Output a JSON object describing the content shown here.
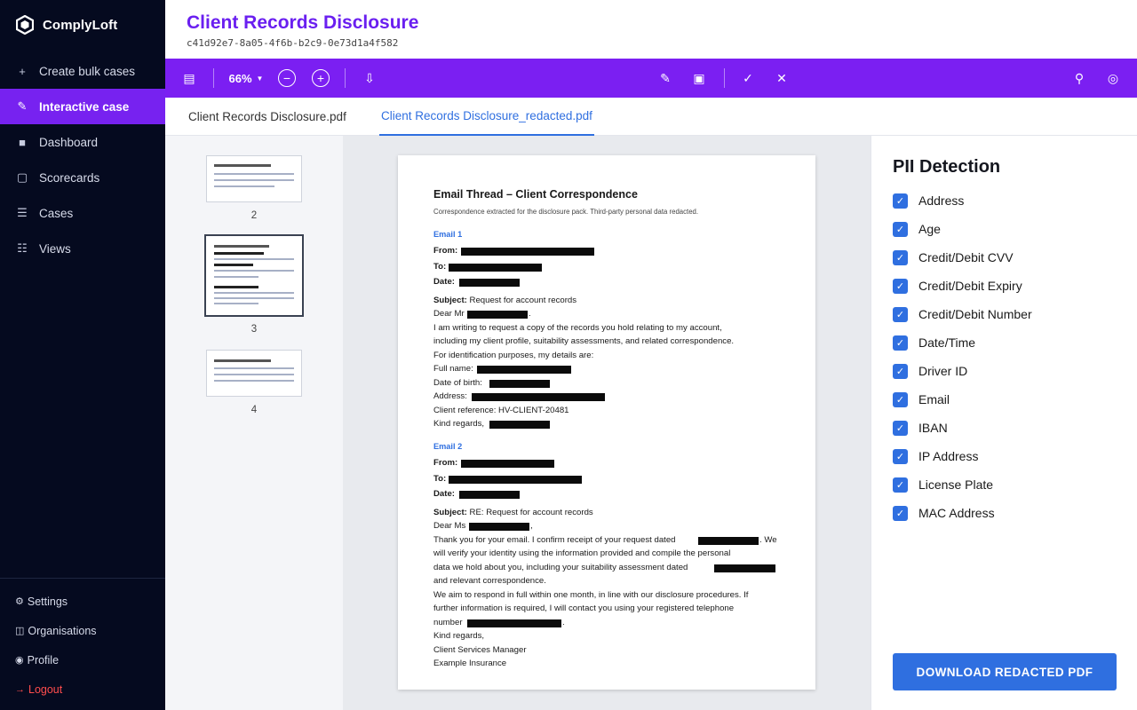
{
  "app": {
    "name": "ComplyLoft"
  },
  "sidebar": {
    "nav": [
      {
        "label": "Create bulk cases",
        "icon": "plus-icon",
        "active": false
      },
      {
        "label": "Interactive case",
        "icon": "pencil-icon",
        "active": true
      },
      {
        "label": "Dashboard",
        "icon": "dashboard-icon",
        "active": false
      },
      {
        "label": "Scorecards",
        "icon": "scorecard-icon",
        "active": false
      },
      {
        "label": "Cases",
        "icon": "list-icon",
        "active": false
      },
      {
        "label": "Views",
        "icon": "views-icon",
        "active": false
      }
    ],
    "bottom": [
      {
        "label": "Settings",
        "icon": "gear-icon"
      },
      {
        "label": "Organisations",
        "icon": "organisations-icon"
      },
      {
        "label": "Profile",
        "icon": "profile-icon"
      },
      {
        "label": "Logout",
        "icon": "logout-arrow-icon"
      }
    ]
  },
  "header": {
    "title": "Client Records Disclosure",
    "id": "c41d92e7-8a05-4f6b-b2c9-0e73d1a4f582"
  },
  "toolbar": {
    "zoom": "66%",
    "icons": [
      "sidebar-toggle-icon",
      "zoom-out-icon",
      "zoom-in-icon",
      "download-arrow-icon",
      "pencil-icon",
      "box-select-icon",
      "accept-check-icon",
      "reject-x-icon",
      "pin-icon",
      "target-icon"
    ]
  },
  "tabs": [
    {
      "label": "Client Records Disclosure.pdf",
      "active": false
    },
    {
      "label": "Client Records Disclosure_redacted.pdf",
      "active": true
    }
  ],
  "thumbnails": [
    {
      "page": "2",
      "selected": false
    },
    {
      "page": "3",
      "selected": true
    },
    {
      "page": "4",
      "selected": false
    }
  ],
  "document": {
    "title": "Email Thread – Client Correspondence",
    "subtitle": "Correspondence extracted for the disclosure pack. Third-party personal data redacted.",
    "email1": {
      "heading": "Email 1",
      "from_label": "From:",
      "to_label": "To:",
      "date_label": "Date:",
      "subject_label": "Subject:",
      "subject": "Request for account records",
      "greeting": "Dear Mr",
      "body1": "I am writing to request a copy of the records you hold relating to my account,",
      "body2": "including my client profile, suitability assessments, and related correspondence.",
      "body3": "For identification purposes, my details are:",
      "full_name": "Full name:",
      "dob": "Date of birth:",
      "address": "Address:",
      "client_ref": "Client reference: HV-CLIENT-20481",
      "sign": "Kind regards,"
    },
    "email2": {
      "heading": "Email 2",
      "from_label": "From:",
      "to_label": "To:",
      "date_label": "Date:",
      "subject_label": "Subject:",
      "subject": "RE: Request for account records",
      "greeting": "Dear Ms",
      "body1": "Thank you for your email. I confirm receipt of your request dated",
      "body1b": ". We",
      "body2": "will verify your identity using the information provided and compile the personal",
      "body3": "data we hold about you, including your suitability assessment dated",
      "body4": "and relevant correspondence.",
      "body5": "We aim to respond in full within one month, in line with our disclosure procedures. If",
      "body6": "further information is required, I will contact you using your registered telephone",
      "body7": "number",
      "sign1": "Kind regards,",
      "sign2": "Client Services Manager",
      "sign3": "Example Insurance"
    }
  },
  "pii": {
    "title": "PII Detection",
    "items": [
      {
        "label": "Address",
        "checked": true
      },
      {
        "label": "Age",
        "checked": true
      },
      {
        "label": "Credit/Debit CVV",
        "checked": true
      },
      {
        "label": "Credit/Debit Expiry",
        "checked": true
      },
      {
        "label": "Credit/Debit Number",
        "checked": true
      },
      {
        "label": "Date/Time",
        "checked": true
      },
      {
        "label": "Driver ID",
        "checked": true
      },
      {
        "label": "Email",
        "checked": true
      },
      {
        "label": "IBAN",
        "checked": true
      },
      {
        "label": "IP Address",
        "checked": true
      },
      {
        "label": "License Plate",
        "checked": true
      },
      {
        "label": "MAC Address",
        "checked": true
      }
    ],
    "download_label": "DOWNLOAD REDACTED PDF"
  },
  "colors": {
    "sidebar_bg": "#050a1f",
    "accent_purple": "#7b1ff2",
    "title_purple": "#6a1ff0",
    "accent_blue": "#2f6fe0",
    "logout_red": "#ff4d4d"
  }
}
